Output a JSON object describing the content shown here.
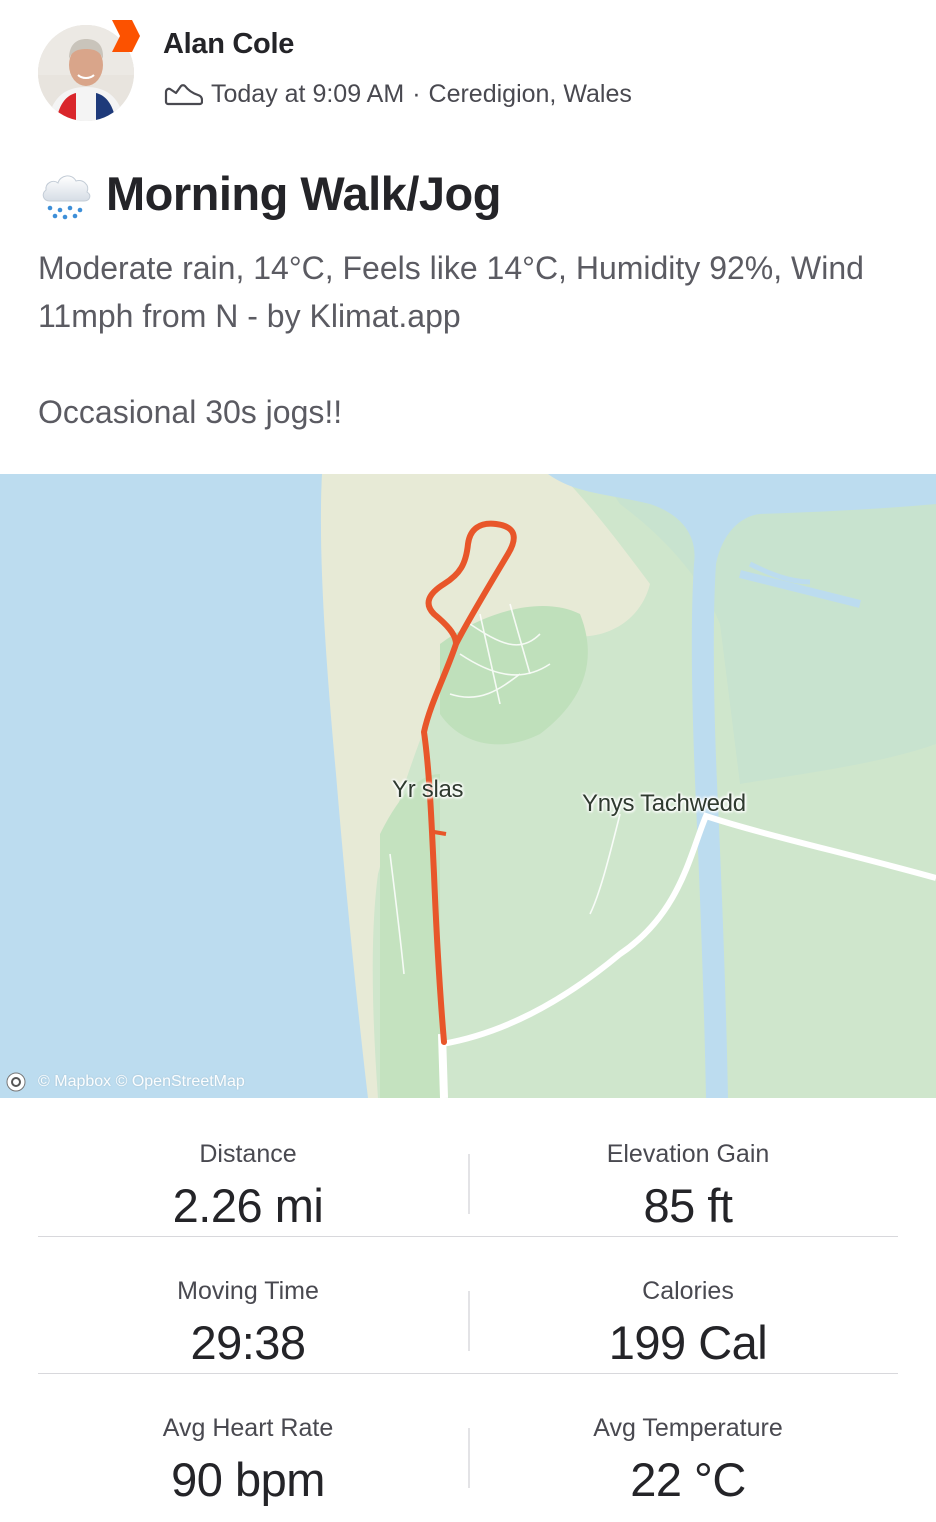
{
  "header": {
    "athlete_name": "Alan Cole",
    "timestamp": "Today at 9:09 AM",
    "separator": "·",
    "location": "Ceredigion, Wales",
    "activity_type_icon": "shoe-icon",
    "badge_icon": "subscriber-chevron-icon",
    "badge_color": "#fc5200"
  },
  "activity": {
    "weather_icon": "rain-cloud-icon",
    "title": "Morning Walk/Jog",
    "description_line1": "Moderate rain, 14°C, Feels like 14°C, Humidity 92%, Wind 11mph from N - by Klimat.app",
    "description_line2": "Occasional 30s jogs!!"
  },
  "map": {
    "labels": {
      "place1": "Yr",
      "place1b": "slas",
      "place2": "Ynys Tachwedd"
    },
    "attribution": "© Mapbox © OpenStreetMap",
    "route_color": "#e8562a",
    "water_color": "#bcdcef",
    "land_color": "#cfe6cc"
  },
  "stats": [
    {
      "left": {
        "label": "Distance",
        "value": "2.26 mi"
      },
      "right": {
        "label": "Elevation Gain",
        "value": "85 ft"
      }
    },
    {
      "left": {
        "label": "Moving Time",
        "value": "29:38"
      },
      "right": {
        "label": "Calories",
        "value": "199 Cal"
      }
    },
    {
      "left": {
        "label": "Avg Heart Rate",
        "value": "90 bpm"
      },
      "right": {
        "label": "Avg Temperature",
        "value": "22 °C"
      }
    }
  ]
}
